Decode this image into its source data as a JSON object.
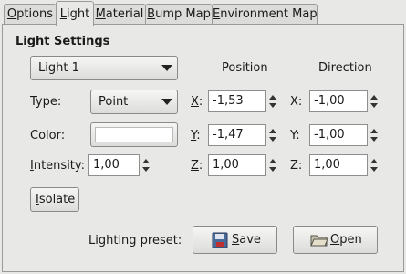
{
  "tabs": [
    {
      "label": "Options",
      "mnemonic": "O",
      "rest": "ptions"
    },
    {
      "label": "Light",
      "mnemonic": "L",
      "rest": "ight"
    },
    {
      "label": "Material",
      "mnemonic": "M",
      "rest": "aterial"
    },
    {
      "label": "Bump Map",
      "mnemonic": "B",
      "rest": "ump Map"
    },
    {
      "label": "Environment Map",
      "mnemonic": "E",
      "rest": "nvironment Map"
    }
  ],
  "active_tab": "Light",
  "light_settings": {
    "title": "Light Settings",
    "light_select": "Light 1",
    "type_label": "Type:",
    "type_value": "Point",
    "color_label": "Color:",
    "color_value": "#ffffff",
    "intensity_label": {
      "mnemonic": "I",
      "rest": "ntensity:"
    },
    "intensity_value": "1,00",
    "isolate_button": {
      "mnemonic": "I",
      "rest": "solate"
    }
  },
  "position": {
    "header": "Position",
    "x_label": {
      "mnemonic": "X",
      "rest": ":"
    },
    "y_label": {
      "mnemonic": "Y",
      "rest": ":"
    },
    "z_label": {
      "mnemonic": "Z",
      "rest": ":"
    },
    "x": "-1,53",
    "y": "-1,47",
    "z": "1,00"
  },
  "direction": {
    "header": "Direction",
    "x_label": "X:",
    "y_label": "Y:",
    "z_label": "Z:",
    "x": "-1,00",
    "y": "-1,00",
    "z": "1,00"
  },
  "preset": {
    "label": "Lighting preset:",
    "save_button": {
      "mnemonic": "S",
      "rest": "ave",
      "icon": "floppy-disk-icon"
    },
    "open_button": {
      "mnemonic": "O",
      "rest": "pen",
      "icon": "folder-icon"
    }
  }
}
